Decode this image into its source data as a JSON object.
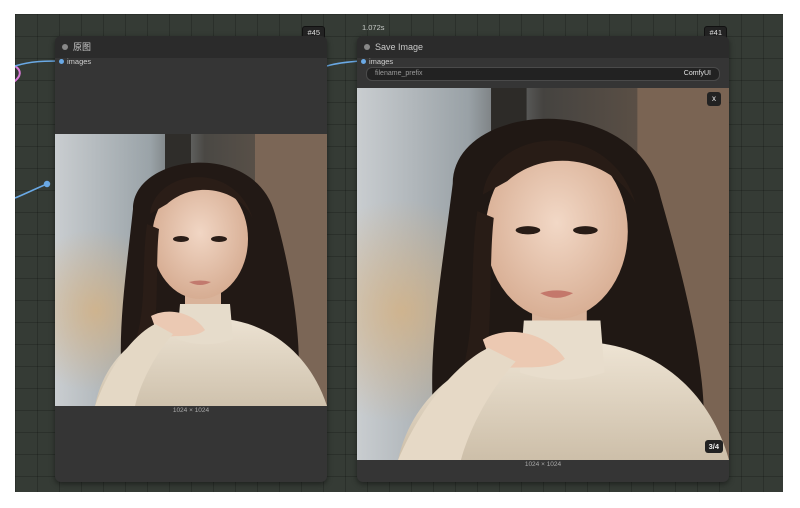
{
  "node_left": {
    "id": "#45",
    "title": "原图",
    "input_label": "images",
    "image_dims": "1024 × 1024"
  },
  "node_right": {
    "id": "#41",
    "exec_time": "1.072s",
    "title": "Save Image",
    "input_label": "images",
    "widget_label": "filename_prefix",
    "widget_value": "ComfyUI",
    "close_label": "x",
    "image_counter": "3/4",
    "image_dims": "1024 × 1024"
  },
  "colors": {
    "canvas": "#353b35",
    "node_body": "#353535",
    "wire_blue": "#6aa9e5",
    "wire_pink": "#d97ad9"
  }
}
